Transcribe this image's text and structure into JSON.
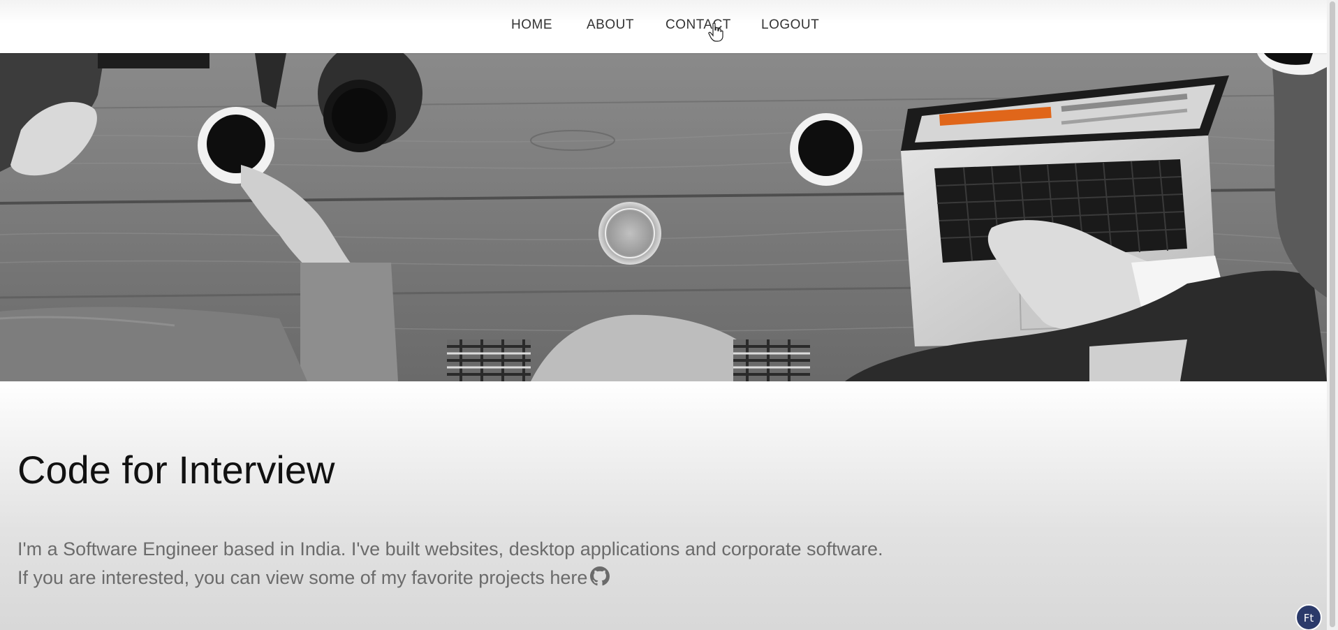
{
  "nav": {
    "items": [
      {
        "label": "HOME"
      },
      {
        "label": "ABOUT"
      },
      {
        "label": "CONTACT"
      },
      {
        "label": "LOGOUT"
      }
    ]
  },
  "hero": {
    "image": "grayscale-desk-laptop-coffee-photo"
  },
  "intro": {
    "title": "Code for Interview",
    "line1": "I'm a Software Engineer based in India. I've built websites, desktop applications and corporate software.",
    "line2": "If you are interested, you can view some of my favorite projects here",
    "github_icon": "github-icon"
  },
  "colors": {
    "title": "#111111",
    "body_text": "#6b6b6b",
    "nav_text": "#333333",
    "laptop_screen_accent": "#e0661a"
  }
}
